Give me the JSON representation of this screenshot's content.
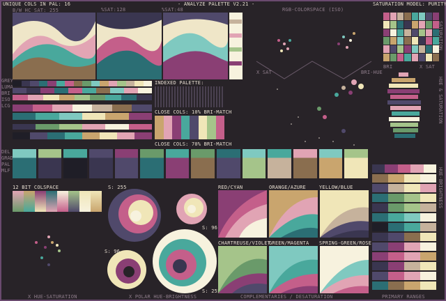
{
  "header": {
    "left": "UNIQUE COLS IN PAL: 16",
    "sub": "B/W HC  SAT: 255",
    "sat_center": "%SAT:128",
    "sat_right": "%SAT:48",
    "title": "- ANALYZE PALETTE V2.21 -",
    "colorspace": "RGB-COLORSPACE (ISO)",
    "model": "SATURATION MODEL: PURITY"
  },
  "left_side_labels": [
    "GREY",
    "LUMA",
    "BRI",
    "ISO",
    "LCG",
    "BRI"
  ],
  "left_lower_labels": [
    "DEL",
    "GRAD",
    "PAL",
    "MLF"
  ],
  "indexed": {
    "title": "INDEXED PALETTE:",
    "close1": "CLOSE COLS: 10% BRI-MATCH",
    "close2": "CLOSE COLS: 70% BRI-MATCH"
  },
  "colorspace": {
    "sat_label": "X SAT",
    "bri_hue_label": "BRI-HUE"
  },
  "right": {
    "bri_label": "BRI",
    "sat_label": "X SAT",
    "vertical1": "SATURATION",
    "vertical2": "HUE & SATURATION",
    "vertical3": "HUE-BRIGHTNESS"
  },
  "bitspace": "12 BIT COLSPACE",
  "polar": {
    "s255": "S: 255",
    "s96": "S: 96",
    "s96b": "S: 96",
    "s255b": "S: 255"
  },
  "complements": {
    "red_cyan": "RED/CYAN",
    "orange_azure": "ORANGE/AZURE",
    "yellow_blue": "YELLOW/BLUE",
    "chartreuse_violet": "CHARTREUSE/VIOLET",
    "green_magenta": "GREEN/MAGENTA",
    "spring_rose": "SPRING-GREEN/ROSE"
  },
  "footer": {
    "hue_sat": "X HUE-SATURATION",
    "polar": "X POLAR HUE-BRIGHTNESS",
    "comp": "COMPLEMENTARIES / DESATURATION",
    "primary": "PRIMARY RANGES"
  },
  "palette": [
    "#1f1e27",
    "#3a3650",
    "#50496b",
    "#8a3f74",
    "#c45f8a",
    "#e1a4b4",
    "#8a6e4f",
    "#c9a56e",
    "#f0e6b8",
    "#f7f2de",
    "#6a9a6a",
    "#a5c48a",
    "#2b6e74",
    "#49a89c",
    "#7fc9c0",
    "#c6b29c"
  ],
  "colors": {
    "bg": "#282328",
    "frame": "#6a4a6e"
  }
}
